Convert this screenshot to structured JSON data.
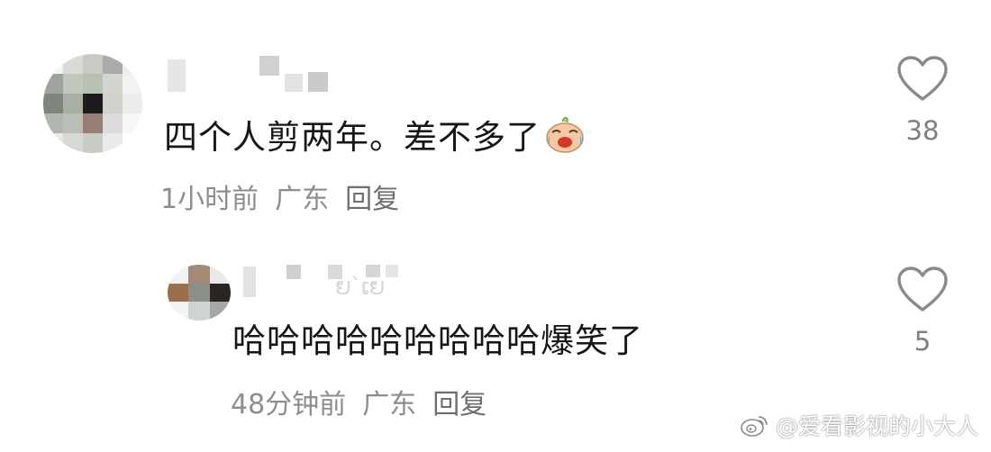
{
  "comments": [
    {
      "text": "四个人剪两年。差不多了",
      "emoji": "crying-laughing-face",
      "time": "1小时前",
      "location": "广东",
      "reply_label": "回复",
      "like_count": "38"
    }
  ],
  "reply": {
    "username_fragment": "ຍ`ເຍ",
    "text": "哈哈哈哈哈哈哈哈哈爆笑了",
    "time": "48分钟前",
    "location": "广东",
    "reply_label": "回复",
    "like_count": "5"
  },
  "watermark": {
    "text": "@爱看影视的小大人",
    "icon": "weibo-logo"
  },
  "colors": {
    "text_primary": "#161616",
    "text_meta": "#8d8d8d",
    "icon_gray": "#8a8a8a",
    "background": "#ffffff"
  }
}
